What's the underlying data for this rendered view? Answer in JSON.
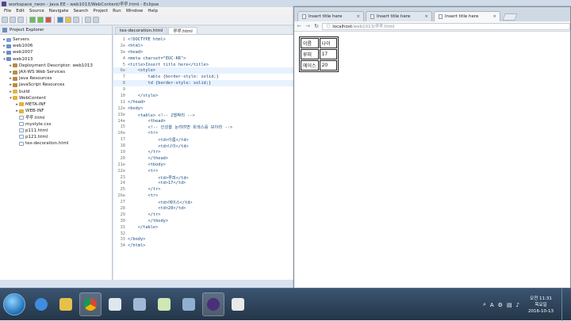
{
  "eclipse": {
    "title": "workspace_neon - Java EE - web1013/WebContent/루루.html - Eclipse",
    "menus": [
      "File",
      "Edit",
      "Source",
      "Navigate",
      "Search",
      "Project",
      "Run",
      "Window",
      "Help"
    ]
  },
  "explorer": {
    "tab_label": "Project Explorer",
    "nodes": [
      {
        "depth": 0,
        "twisty": "▸",
        "icon": "server",
        "label": "Servers"
      },
      {
        "depth": 0,
        "twisty": "▸",
        "icon": "project",
        "label": "web1006"
      },
      {
        "depth": 0,
        "twisty": "▸",
        "icon": "project",
        "label": "web1007"
      },
      {
        "depth": 0,
        "twisty": "▾",
        "icon": "project",
        "label": "web1013"
      },
      {
        "depth": 1,
        "twisty": "▸",
        "icon": "lib",
        "label": "Deployment Descriptor: web1013"
      },
      {
        "depth": 1,
        "twisty": "▸",
        "icon": "lib",
        "label": "JAX-WS Web Services"
      },
      {
        "depth": 1,
        "twisty": "▸",
        "icon": "lib",
        "label": "Java Resources"
      },
      {
        "depth": 1,
        "twisty": "▸",
        "icon": "lib",
        "label": "JavaScript Resources"
      },
      {
        "depth": 1,
        "twisty": "▸",
        "icon": "folder",
        "label": "build"
      },
      {
        "depth": 1,
        "twisty": "▾",
        "icon": "folder",
        "label": "WebContent"
      },
      {
        "depth": 2,
        "twisty": "▸",
        "icon": "folder",
        "label": "META-INF"
      },
      {
        "depth": 2,
        "twisty": "▸",
        "icon": "folder",
        "label": "WEB-INF"
      },
      {
        "depth": 2,
        "twisty": "",
        "icon": "file",
        "label": "루루.html"
      },
      {
        "depth": 2,
        "twisty": "",
        "icon": "file",
        "label": "mystyle.css"
      },
      {
        "depth": 2,
        "twisty": "",
        "icon": "file",
        "label": "p111.html"
      },
      {
        "depth": 2,
        "twisty": "",
        "icon": "file",
        "label": "p121.html"
      },
      {
        "depth": 2,
        "twisty": "",
        "icon": "file",
        "label": "tex-decoration.html"
      }
    ]
  },
  "editor": {
    "tabs": [
      {
        "label": "tex-decoration.html",
        "active": false
      },
      {
        "label": "루루.html",
        "active": true
      }
    ],
    "lines": [
      {
        "no": "1",
        "text": "<!DOCTYPE html>"
      },
      {
        "no": "2⊖",
        "text": "<html>"
      },
      {
        "no": "3⊖",
        "text": "<head>"
      },
      {
        "no": "4",
        "text": "<meta charset=\"EUC-KR\">"
      },
      {
        "no": "5",
        "text": "<title>Insert title here</title>"
      },
      {
        "no": "6⊖",
        "text": "    <style>",
        "hl": true
      },
      {
        "no": "7",
        "text": "        table {border-style: solid;}"
      },
      {
        "no": "8",
        "text": "        td {border-style: solid;}",
        "hl": true
      },
      {
        "no": "9",
        "text": ""
      },
      {
        "no": "10",
        "text": "    </style>"
      },
      {
        "no": "11",
        "text": "</head>"
      },
      {
        "no": "12⊖",
        "text": "<body>"
      },
      {
        "no": "13⊖",
        "text": "    <table> <!-- 2행짜리 -->"
      },
      {
        "no": "14⊖",
        "text": "        <thead>"
      },
      {
        "no": "15",
        "text": "        <!-- 인성을 눈려려면 회색스를 보이라 -->"
      },
      {
        "no": "16⊖",
        "text": "        <tr>"
      },
      {
        "no": "17",
        "text": "            <td>이름</td>"
      },
      {
        "no": "18",
        "text": "            <td>나이</td>"
      },
      {
        "no": "19",
        "text": "        </tr>"
      },
      {
        "no": "20",
        "text": "        </thead>"
      },
      {
        "no": "21⊖",
        "text": "        <tbody>"
      },
      {
        "no": "22⊖",
        "text": "        <tr>"
      },
      {
        "no": "23",
        "text": "            <td>루피</td>"
      },
      {
        "no": "24",
        "text": "            <td>17</td>"
      },
      {
        "no": "25",
        "text": "        </tr>"
      },
      {
        "no": "26⊖",
        "text": "        <tr>"
      },
      {
        "no": "27",
        "text": "            <td>에이스</td>"
      },
      {
        "no": "28",
        "text": "            <td>20</td>"
      },
      {
        "no": "29",
        "text": "        </tr>"
      },
      {
        "no": "30",
        "text": "        </tbody>"
      },
      {
        "no": "31",
        "text": "    </table>"
      },
      {
        "no": "32",
        "text": ""
      },
      {
        "no": "33",
        "text": "</body>"
      },
      {
        "no": "34",
        "text": "</html>"
      }
    ]
  },
  "browser": {
    "tabs": [
      {
        "label": "Insert title here",
        "active": false
      },
      {
        "label": "Insert title here",
        "active": false
      },
      {
        "label": "Insert title here",
        "active": true
      }
    ],
    "url_host": "localhost",
    "url_path": "/web1013/루루.html",
    "table": [
      [
        "이름",
        "나이"
      ],
      [
        "루피",
        "17"
      ],
      [
        "에이스",
        "20"
      ]
    ]
  },
  "taskbar": {
    "tray_lang": "A",
    "clock_time": "오전 11:31",
    "clock_day": "목요일",
    "clock_date": "2016-10-13"
  }
}
